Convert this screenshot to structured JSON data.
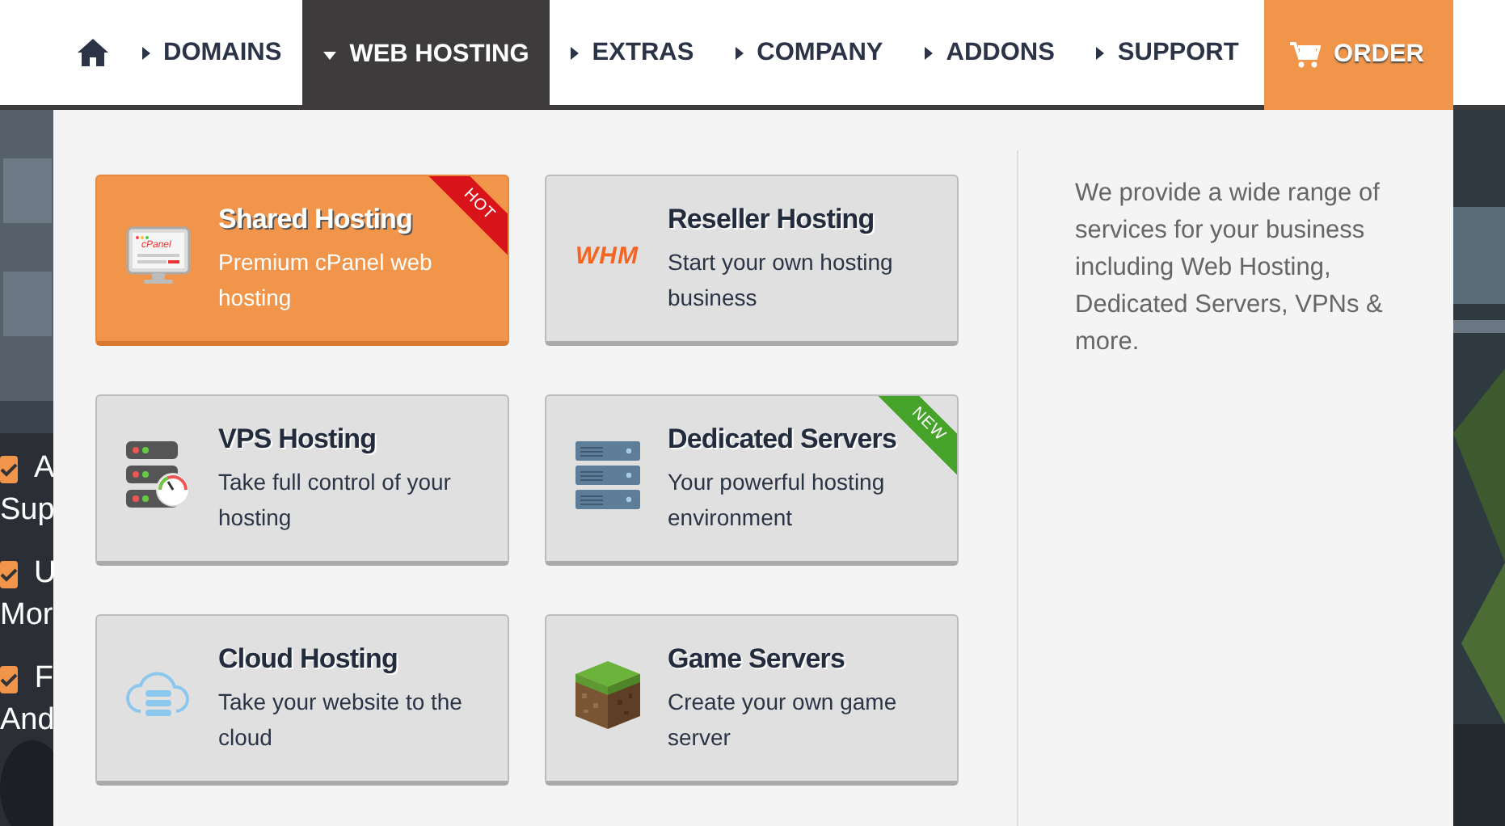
{
  "nav": {
    "items": [
      {
        "label": "DOMAINS",
        "kind": "menu",
        "selected": false
      },
      {
        "label": "WEB HOSTING",
        "kind": "menu",
        "selected": true
      },
      {
        "label": "EXTRAS",
        "kind": "menu",
        "selected": false
      },
      {
        "label": "COMPANY",
        "kind": "menu",
        "selected": false
      },
      {
        "label": "ADDONS",
        "kind": "menu",
        "selected": false
      },
      {
        "label": "SUPPORT",
        "kind": "menu",
        "selected": false
      },
      {
        "label": "ORDER",
        "kind": "order",
        "selected": false
      }
    ]
  },
  "background_features": [
    {
      "checked": true,
      "text": "A",
      "subtext": "Sup"
    },
    {
      "checked": true,
      "text": "U",
      "subtext": "Mor"
    },
    {
      "checked": true,
      "text": "F",
      "subtext": "And"
    }
  ],
  "dropdown": {
    "cards": [
      {
        "title": "Shared Hosting",
        "description": "Premium cPanel web hosting",
        "selected": true,
        "icon_text": "cPanel",
        "badge": {
          "text": "HOT",
          "color": "#d9131a"
        }
      },
      {
        "title": "Reseller Hosting",
        "description": "Start your own hosting business",
        "selected": false,
        "icon_text": "WHM"
      },
      {
        "title": "VPS Hosting",
        "description": "Take full control of your hosting",
        "selected": false
      },
      {
        "title": "Dedicated Servers",
        "description": "Your powerful hosting environment",
        "selected": false,
        "badge": {
          "text": "NEW",
          "color": "#45a329"
        }
      },
      {
        "title": "Cloud Hosting",
        "description": "Take your website to the cloud",
        "selected": false
      },
      {
        "title": "Game Servers",
        "description": "Create your own game server",
        "selected": false
      }
    ],
    "intro": "We provide a wide range of services for your business including Web Hosting, Dedicated Servers, VPNs & more."
  }
}
